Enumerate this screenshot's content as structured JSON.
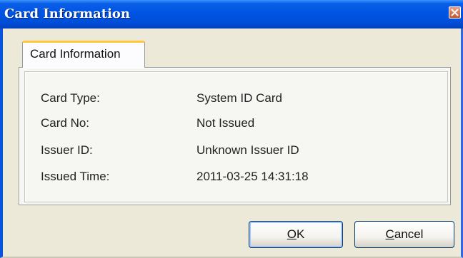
{
  "window": {
    "title": "Card Information",
    "close_icon": "close-icon",
    "accent_color": "#0054e3",
    "close_color": "#c4542e"
  },
  "tab": {
    "label": "Card Information",
    "highlight_color": "#ffc83c"
  },
  "fields": [
    {
      "label": "Card Type:",
      "value": "System ID Card"
    },
    {
      "label": "Card No:",
      "value": "Not Issued"
    },
    {
      "label": "Issuer ID:",
      "value": "Unknown Issuer ID"
    },
    {
      "label": "Issued Time:",
      "value": "2011-03-25 14:31:18"
    }
  ],
  "buttons": {
    "ok_mnemonic": "O",
    "ok_rest": "K",
    "cancel_mnemonic": "C",
    "cancel_rest": "ancel"
  }
}
